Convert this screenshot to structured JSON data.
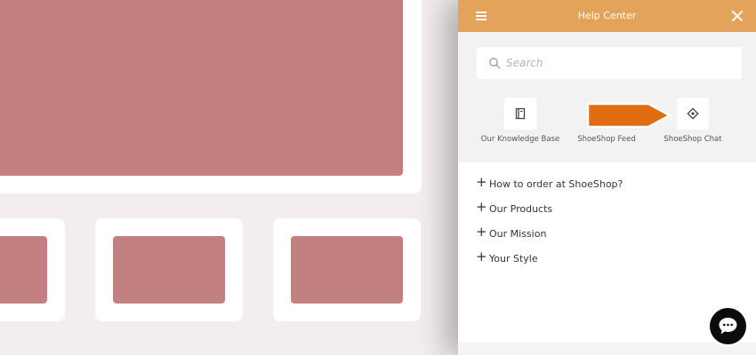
{
  "header": {
    "title": "Help Center",
    "menu_icon": "hamburger-icon",
    "close_icon": "close-icon"
  },
  "search": {
    "placeholder": "Search",
    "value": "",
    "icon": "search-icon"
  },
  "tiles": [
    {
      "label": "Our Knowledge Base",
      "icon": "book-icon"
    },
    {
      "label": "ShoeShop Feed",
      "icon": "arrow-pointer-icon"
    },
    {
      "label": "ShoeShop Chat",
      "icon": "chat-diamond-icon"
    }
  ],
  "faq": [
    {
      "label": "How to order at ShoeShop?"
    },
    {
      "label": "Our Products"
    },
    {
      "label": "Our Mission"
    },
    {
      "label": "Your Style"
    }
  ],
  "colors": {
    "header_bg": "#e3a35a",
    "arrow": "#e06d12",
    "placeholder_image": "#c38080",
    "page_bg": "#f3eded",
    "chat_button": "#0b0b0b"
  },
  "chat_button": {
    "icon": "chat-bubble-icon"
  }
}
